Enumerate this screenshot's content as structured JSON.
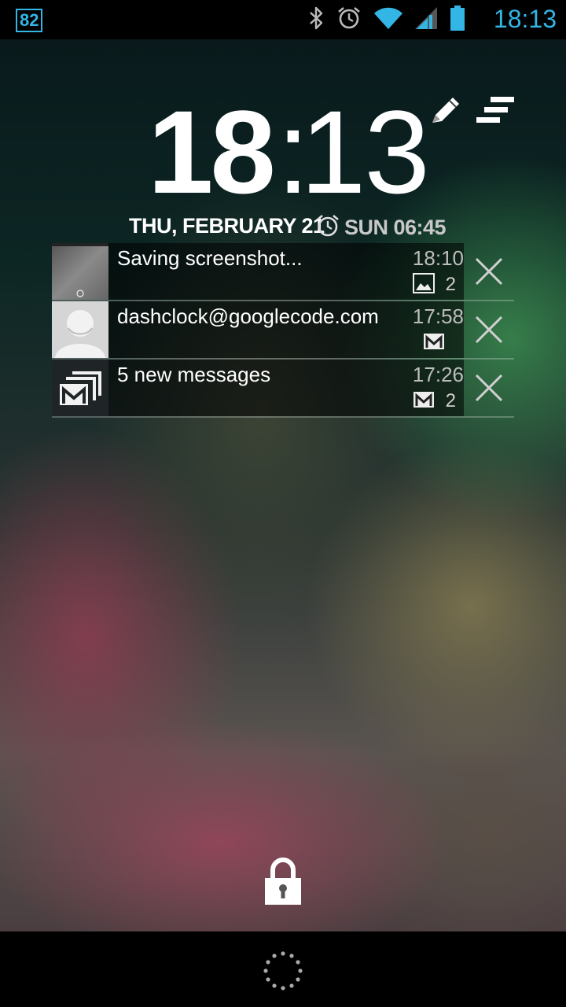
{
  "status_bar": {
    "badge": "82",
    "time": "18:13",
    "icons": [
      "bluetooth-icon",
      "alarm-icon",
      "wifi-icon",
      "signal-icon",
      "battery-icon"
    ],
    "accent_color": "#33b5e5"
  },
  "clock": {
    "hours": "18",
    "separator": ":",
    "minutes": "13"
  },
  "date": "THU, FEBRUARY 21",
  "alarm": "SUN 06:45",
  "notifications": [
    {
      "title": "Saving screenshot...",
      "time": "18:10",
      "app_icon": "image-icon",
      "count": "2",
      "thumb": "screenshot-thumbnail"
    },
    {
      "title": "dashclock@googlecode.com",
      "time": "17:58",
      "app_icon": "gmail-icon",
      "count": "",
      "thumb": "contact-avatar"
    },
    {
      "title": "5 new messages",
      "time": "17:26",
      "app_icon": "gmail-icon",
      "count": "2",
      "thumb": "gmail-multi-icon"
    }
  ],
  "bottom": {
    "lock_icon": "lock-icon",
    "nav_icon": "loading-spinner-icon"
  }
}
